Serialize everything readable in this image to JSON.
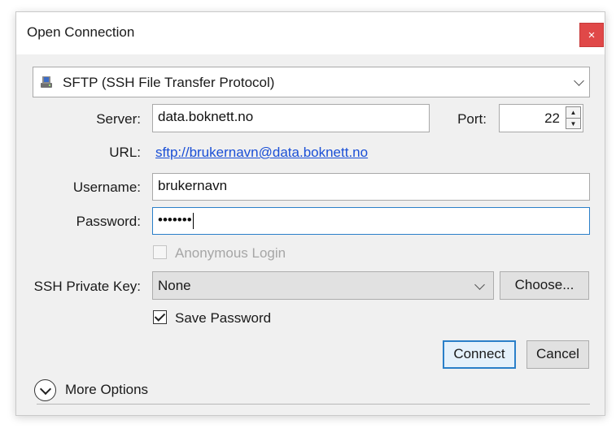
{
  "dialog": {
    "title": "Open Connection",
    "close_label": "×"
  },
  "protocol": {
    "selected": "SFTP (SSH File Transfer Protocol)",
    "icon": "drive-icon"
  },
  "server": {
    "label": "Server:",
    "value": "data.boknett.no"
  },
  "port": {
    "label": "Port:",
    "value": "22",
    "up": "▲",
    "down": "▼"
  },
  "url": {
    "label": "URL:",
    "value": "sftp://brukernavn@data.boknett.no"
  },
  "username": {
    "label": "Username:",
    "value": "brukernavn"
  },
  "password": {
    "label": "Password:",
    "value": "•••••••"
  },
  "anonymous": {
    "label": "Anonymous Login",
    "checked": false,
    "disabled": true
  },
  "ssh_key": {
    "label": "SSH Private Key:",
    "selected": "None",
    "choose_label": "Choose..."
  },
  "save_password": {
    "label": "Save Password",
    "checked": true
  },
  "buttons": {
    "connect": "Connect",
    "cancel": "Cancel"
  },
  "more_options": {
    "label": "More Options"
  },
  "colors": {
    "close": "#e04848",
    "link": "#1a4fd6",
    "focus": "#2a7fc9"
  }
}
